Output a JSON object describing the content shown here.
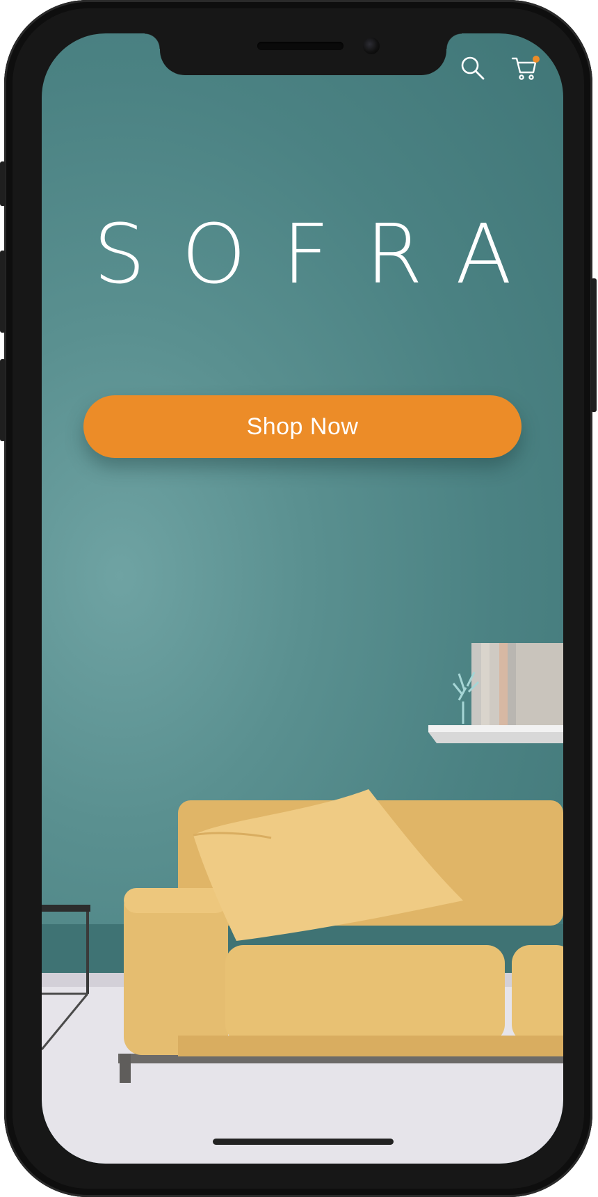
{
  "header": {
    "search_icon": "search-icon",
    "cart_icon": "cart-icon",
    "cart_badge_color": "#ec8c28"
  },
  "hero": {
    "brand_name": "SOFRA",
    "cta_label": "Shop Now"
  },
  "colors": {
    "background": "#4b8283",
    "accent": "#ec8c28",
    "text": "#ffffff"
  }
}
